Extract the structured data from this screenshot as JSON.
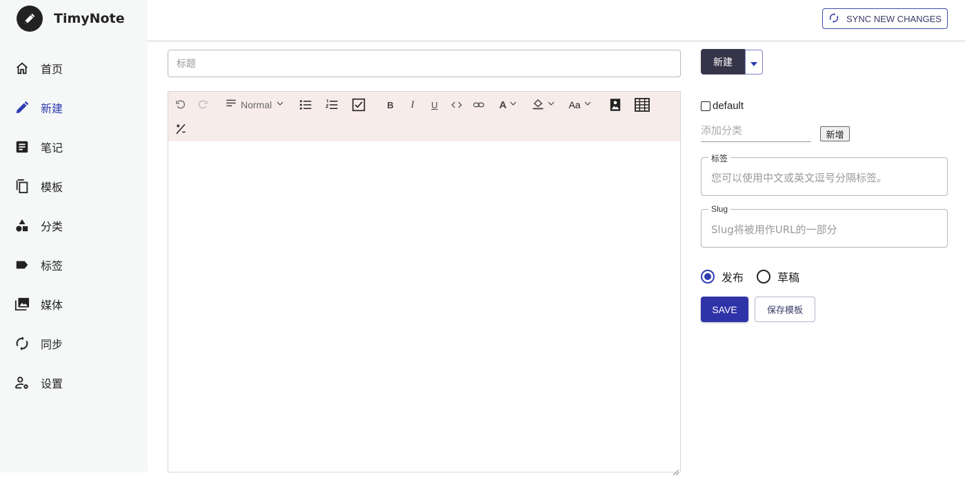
{
  "app": {
    "name": "TimyNote"
  },
  "nav": [
    {
      "label": "首页",
      "icon": "home-icon"
    },
    {
      "label": "新建",
      "icon": "pencil-icon",
      "active": true
    },
    {
      "label": "笔记",
      "icon": "note-icon"
    },
    {
      "label": "模板",
      "icon": "copy-icon"
    },
    {
      "label": "分类",
      "icon": "shapes-icon"
    },
    {
      "label": "标签",
      "icon": "label-icon"
    },
    {
      "label": "媒体",
      "icon": "photo-library-icon"
    },
    {
      "label": "同步",
      "icon": "sync-icon"
    },
    {
      "label": "设置",
      "icon": "user-settings-icon"
    }
  ],
  "topbar": {
    "sync_label": "SYNC NEW CHANGES"
  },
  "editor": {
    "title_placeholder": "标题",
    "block_type": "Normal",
    "bold": "B",
    "italic": "I",
    "underline": "U",
    "font_color": "A",
    "font_size": "Aa"
  },
  "actions": {
    "new_label": "新建"
  },
  "category": {
    "checkbox_label": "default",
    "add_placeholder": "添加分类",
    "add_button": "新增"
  },
  "tags": {
    "label": "标签",
    "placeholder": "您可以使用中文或英文逗号分隔标签。"
  },
  "slug": {
    "label": "Slug",
    "placeholder": "Slug将被用作URL的一部分"
  },
  "status": {
    "publish": "发布",
    "draft": "草稿",
    "selected": "publish"
  },
  "buttons": {
    "save": "SAVE",
    "save_template": "保存模板"
  },
  "colors": {
    "accent": "#2f33a8",
    "toolbar_bg": "#f8eceb",
    "sidebar_bg": "#f5f8f7"
  }
}
